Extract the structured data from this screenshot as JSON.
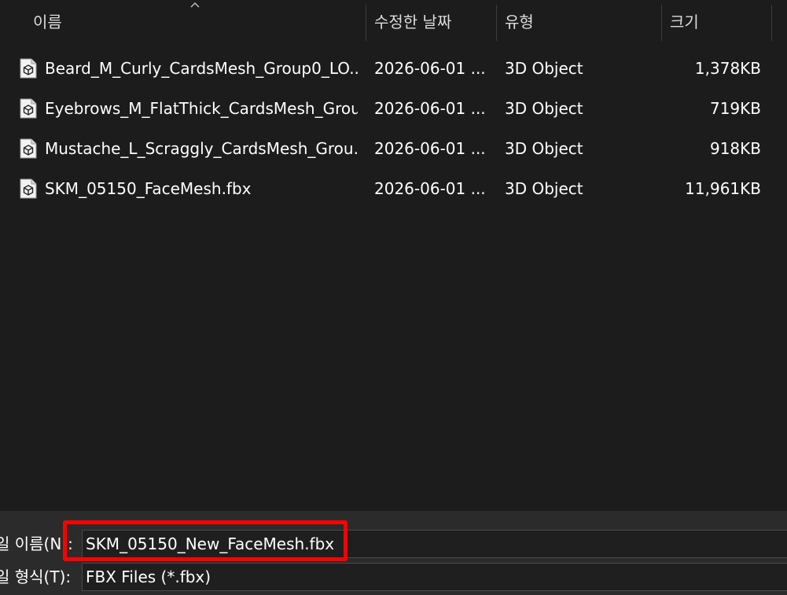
{
  "columns": {
    "name": "이름",
    "modified": "수정한 날짜",
    "type": "유형",
    "size": "크기"
  },
  "files": [
    {
      "name": "Beard_M_Curly_CardsMesh_Group0_LO...",
      "modified": "2026-06-01 ...",
      "type": "3D Object",
      "size": "1,378KB"
    },
    {
      "name": "Eyebrows_M_FlatThick_CardsMesh_Grou...",
      "modified": "2026-06-01 ...",
      "type": "3D Object",
      "size": "719KB"
    },
    {
      "name": "Mustache_L_Scraggly_CardsMesh_Grou...",
      "modified": "2026-06-01 ...",
      "type": "3D Object",
      "size": "918KB"
    },
    {
      "name": "SKM_05150_FaceMesh.fbx",
      "modified": "2026-06-01 ...",
      "type": "3D Object",
      "size": "11,961KB"
    }
  ],
  "filename_field": {
    "label": "일 이름(N):",
    "value": "SKM_05150_New_FaceMesh.fbx"
  },
  "filetype_field": {
    "label": "일 형식(T):",
    "value": "FBX Files (*.fbx)"
  },
  "colors": {
    "background": "#1c1c1c",
    "bottom_panel": "#2b2b2b",
    "highlight": "#ff0000"
  }
}
